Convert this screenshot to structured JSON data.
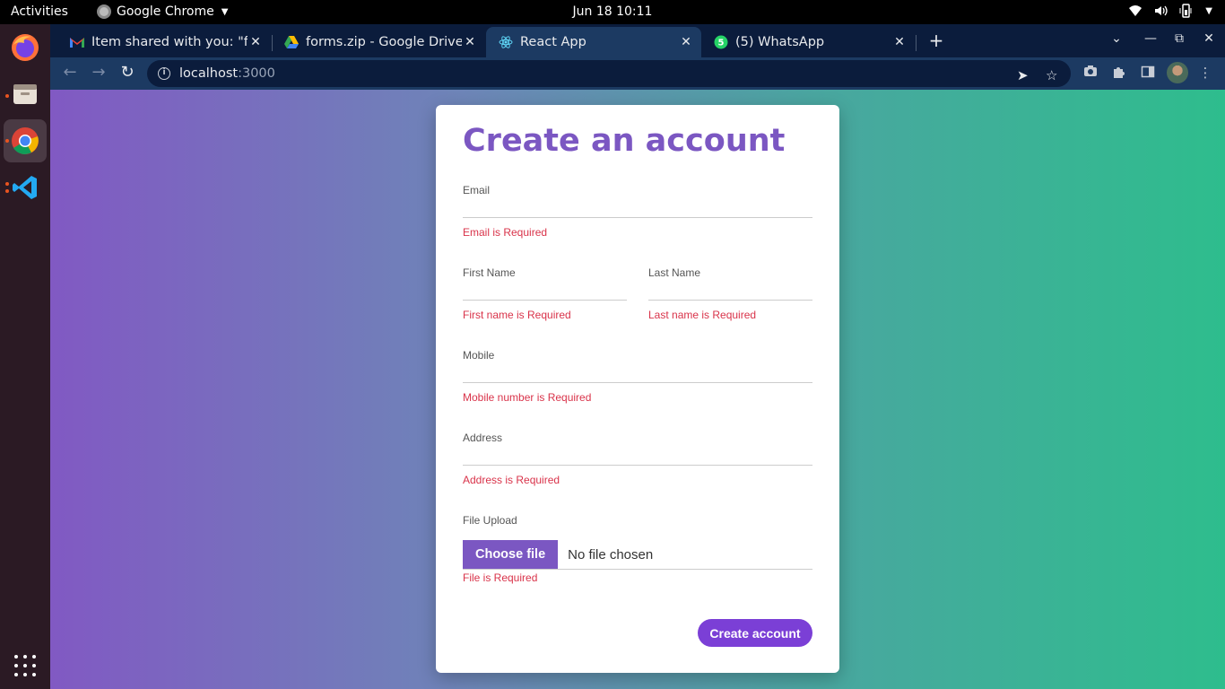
{
  "system": {
    "activities": "Activities",
    "app_name": "Google Chrome",
    "clock": "Jun 18  10:11"
  },
  "dock": {
    "items": [
      {
        "name": "Firefox"
      },
      {
        "name": "Files"
      },
      {
        "name": "Google Chrome"
      },
      {
        "name": "Visual Studio Code"
      }
    ]
  },
  "browser": {
    "tabs": [
      {
        "title": "Item shared with you: \"forms.zip\"",
        "favicon": "gmail-icon"
      },
      {
        "title": "forms.zip - Google Drive",
        "favicon": "google-drive-icon"
      },
      {
        "title": "React App",
        "favicon": "react-icon"
      },
      {
        "title": "(5) WhatsApp",
        "favicon": "whatsapp-icon",
        "badge": "5"
      }
    ],
    "active_tab": 2,
    "url_host": "localhost",
    "url_port": ":3000"
  },
  "form": {
    "title": "Create an account",
    "email": {
      "label": "Email",
      "value": "",
      "error": "Email is Required"
    },
    "first_name": {
      "label": "First Name",
      "value": "",
      "error": "First name is Required"
    },
    "last_name": {
      "label": "Last Name",
      "value": "",
      "error": "Last name is Required"
    },
    "mobile": {
      "label": "Mobile",
      "value": "",
      "error": "Mobile number is Required"
    },
    "address": {
      "label": "Address",
      "value": "",
      "error": "Address is Required"
    },
    "file": {
      "label": "File Upload",
      "button": "Choose file",
      "status": "No file chosen",
      "error": "File is Required"
    },
    "submit": "Create account"
  },
  "colors": {
    "accent": "#7b57c2",
    "error": "#d9334a",
    "submit": "#7b3fd6"
  }
}
